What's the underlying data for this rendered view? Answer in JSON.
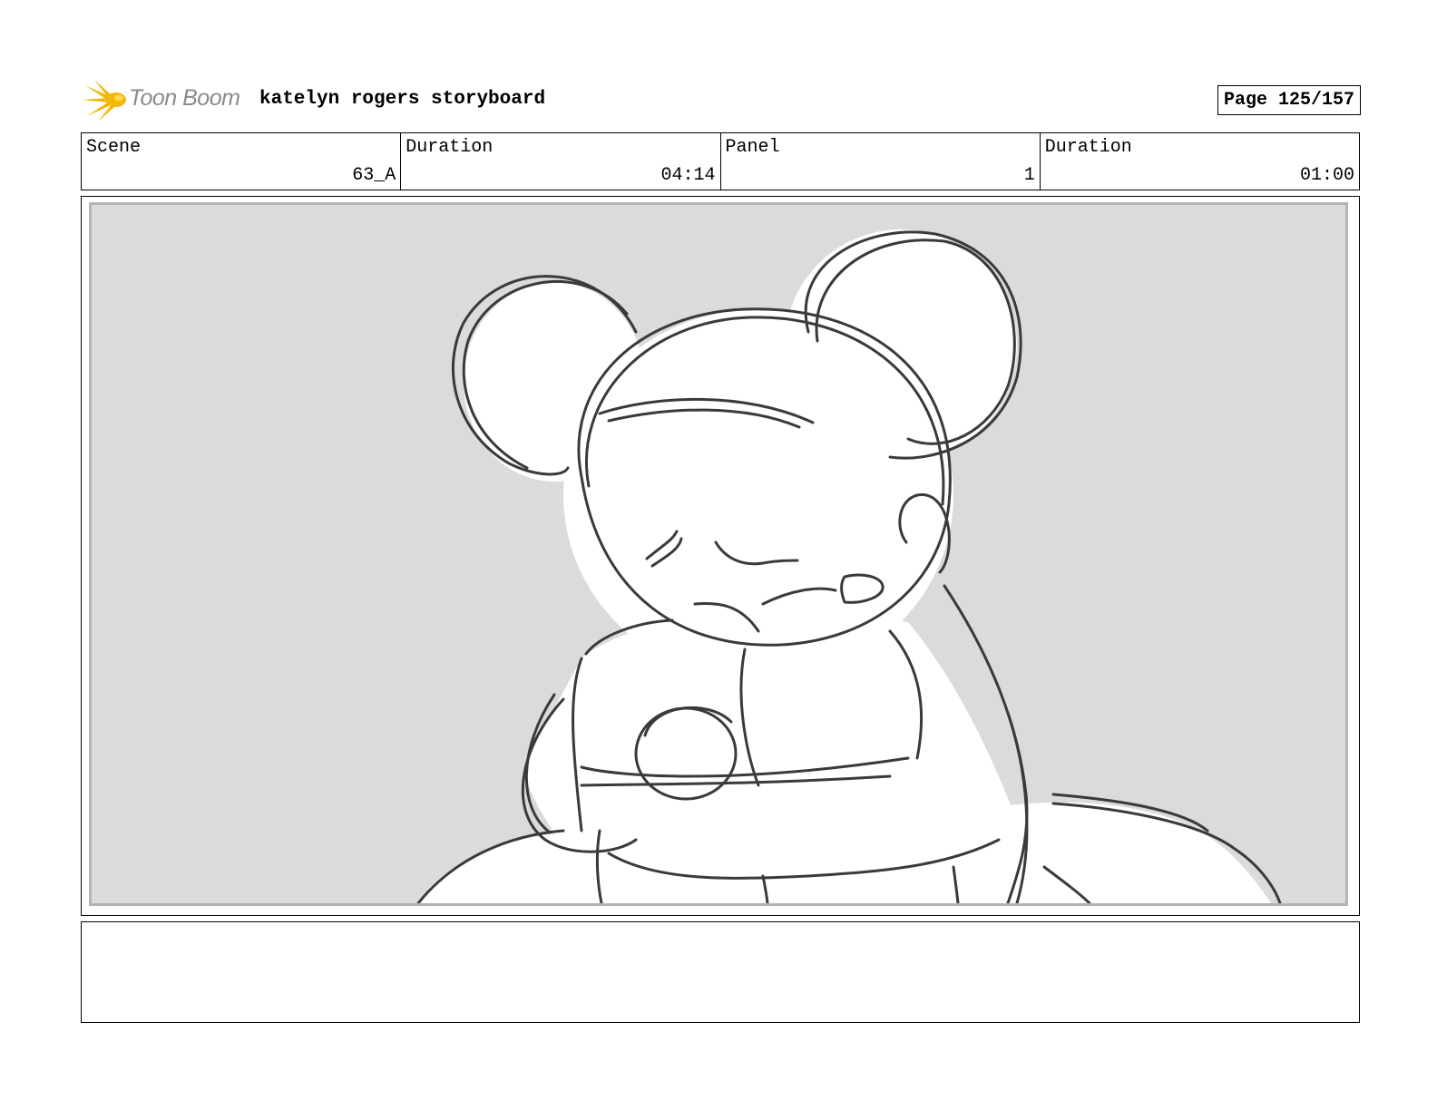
{
  "header": {
    "logo_text": "Toon Boom",
    "title": "katelyn rogers storyboard",
    "page_label": "Page 125/157"
  },
  "info": [
    {
      "label": "Scene",
      "value": "63_A"
    },
    {
      "label": "Duration",
      "value": "04:14"
    },
    {
      "label": "Panel",
      "value": "1"
    },
    {
      "label": "Duration",
      "value": "01:00"
    }
  ],
  "panel": {
    "background": "#dbdbdb",
    "border_color": "#b4b4b4",
    "stroke_color": "#3a3a3a",
    "sketch_subject": "rough sketch of a sad round-eared character hugging itself"
  },
  "notes": {
    "text": ""
  },
  "colors": {
    "logo_gold": "#f2b705",
    "logo_text": "#8a8a8a"
  }
}
